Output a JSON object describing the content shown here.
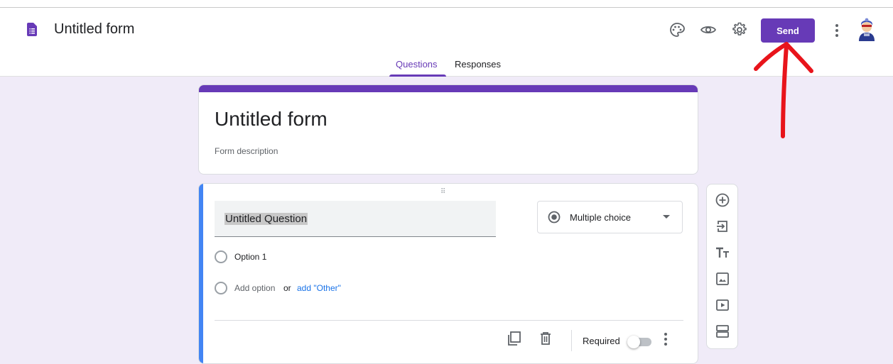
{
  "header": {
    "title": "Untitled form",
    "send_label": "Send",
    "icons": [
      "forms-doc-icon",
      "palette-icon",
      "eye-icon",
      "gear-icon",
      "more-vert-icon",
      "avatar"
    ]
  },
  "tabs": {
    "questions": "Questions",
    "responses": "Responses",
    "active": "Questions"
  },
  "form": {
    "title": "Untitled form",
    "description": "Form description"
  },
  "question": {
    "title": "Untitled Question",
    "type": "Multiple choice",
    "options": [
      "Option 1"
    ],
    "add_option": "Add option",
    "or": "or",
    "add_other": "add \"Other\"",
    "required_label": "Required",
    "required": false
  },
  "side_toolbar": [
    "add-question-icon",
    "import-questions-icon",
    "add-title-icon",
    "add-image-icon",
    "add-video-icon",
    "add-section-icon"
  ],
  "colors": {
    "accent": "#673ab7",
    "canvas": "#f0ebf8",
    "question_accent": "#4285f4",
    "link": "#1a73e8",
    "annotation": "#e8141b"
  }
}
